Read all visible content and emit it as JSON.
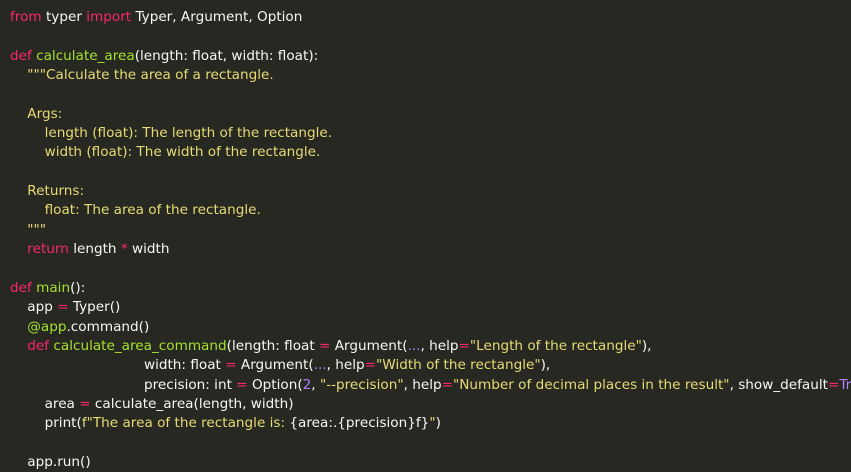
{
  "theme": {
    "background": "#272822",
    "plain": "#f8f8f2",
    "keyword": "#f92672",
    "function": "#a6e22e",
    "string": "#e6db74",
    "number": "#ae81ff"
  },
  "code": {
    "lines": [
      [
        [
          "kw",
          "from"
        ],
        [
          "plain",
          " typer "
        ],
        [
          "kw",
          "import"
        ],
        [
          "plain",
          " Typer, Argument, Option"
        ]
      ],
      [],
      [
        [
          "kw",
          "def"
        ],
        [
          "plain",
          " "
        ],
        [
          "fn",
          "calculate_area"
        ],
        [
          "plain",
          "(length: float, width: float):"
        ]
      ],
      [
        [
          "plain",
          "    "
        ],
        [
          "str",
          "\"\"\"Calculate the area of a rectangle."
        ]
      ],
      [],
      [
        [
          "plain",
          "    "
        ],
        [
          "str",
          "Args:"
        ]
      ],
      [
        [
          "plain",
          "        "
        ],
        [
          "str",
          "length (float): The length of the rectangle."
        ]
      ],
      [
        [
          "plain",
          "        "
        ],
        [
          "str",
          "width (float): The width of the rectangle."
        ]
      ],
      [],
      [
        [
          "plain",
          "    "
        ],
        [
          "str",
          "Returns:"
        ]
      ],
      [
        [
          "plain",
          "        "
        ],
        [
          "str",
          "float: The area of the rectangle."
        ]
      ],
      [
        [
          "plain",
          "    "
        ],
        [
          "str",
          "\"\"\""
        ]
      ],
      [
        [
          "plain",
          "    "
        ],
        [
          "kw",
          "return"
        ],
        [
          "plain",
          " length "
        ],
        [
          "kw",
          "*"
        ],
        [
          "plain",
          " width"
        ]
      ],
      [],
      [
        [
          "kw",
          "def"
        ],
        [
          "plain",
          " "
        ],
        [
          "fn",
          "main"
        ],
        [
          "plain",
          "():"
        ]
      ],
      [
        [
          "plain",
          "    app "
        ],
        [
          "kw",
          "="
        ],
        [
          "plain",
          " Typer()"
        ]
      ],
      [
        [
          "plain",
          "    "
        ],
        [
          "fn",
          "@app"
        ],
        [
          "plain",
          ".command()"
        ]
      ],
      [
        [
          "plain",
          "    "
        ],
        [
          "kw",
          "def"
        ],
        [
          "plain",
          " "
        ],
        [
          "fn",
          "calculate_area_command"
        ],
        [
          "plain",
          "(length: float "
        ],
        [
          "kw",
          "="
        ],
        [
          "plain",
          " Argument("
        ],
        [
          "num",
          "..."
        ],
        [
          "plain",
          ", help"
        ],
        [
          "kw",
          "="
        ],
        [
          "str",
          "\"Length of the rectangle\""
        ],
        [
          "plain",
          "),"
        ]
      ],
      [
        [
          "plain",
          "                               width: float "
        ],
        [
          "kw",
          "="
        ],
        [
          "plain",
          " Argument("
        ],
        [
          "num",
          "..."
        ],
        [
          "plain",
          ", help"
        ],
        [
          "kw",
          "="
        ],
        [
          "str",
          "\"Width of the rectangle\""
        ],
        [
          "plain",
          "),"
        ]
      ],
      [
        [
          "plain",
          "                               precision: int "
        ],
        [
          "kw",
          "="
        ],
        [
          "plain",
          " Option("
        ],
        [
          "num",
          "2"
        ],
        [
          "plain",
          ", "
        ],
        [
          "str",
          "\"--precision\""
        ],
        [
          "plain",
          ", help"
        ],
        [
          "kw",
          "="
        ],
        [
          "str",
          "\"Number of decimal places in the result\""
        ],
        [
          "plain",
          ", show_default"
        ],
        [
          "kw",
          "="
        ],
        [
          "num",
          "True"
        ],
        [
          "plain",
          "):"
        ]
      ],
      [
        [
          "plain",
          "        area "
        ],
        [
          "kw",
          "="
        ],
        [
          "plain",
          " calculate_area(length, width)"
        ]
      ],
      [
        [
          "plain",
          "        print("
        ],
        [
          "str",
          "f\"The area of the rectangle is: "
        ],
        [
          "plain",
          "{area:.{precision}f}"
        ],
        [
          "str",
          "\""
        ],
        [
          "plain",
          ")"
        ]
      ],
      [],
      [
        [
          "plain",
          "    app.run()"
        ]
      ]
    ]
  }
}
